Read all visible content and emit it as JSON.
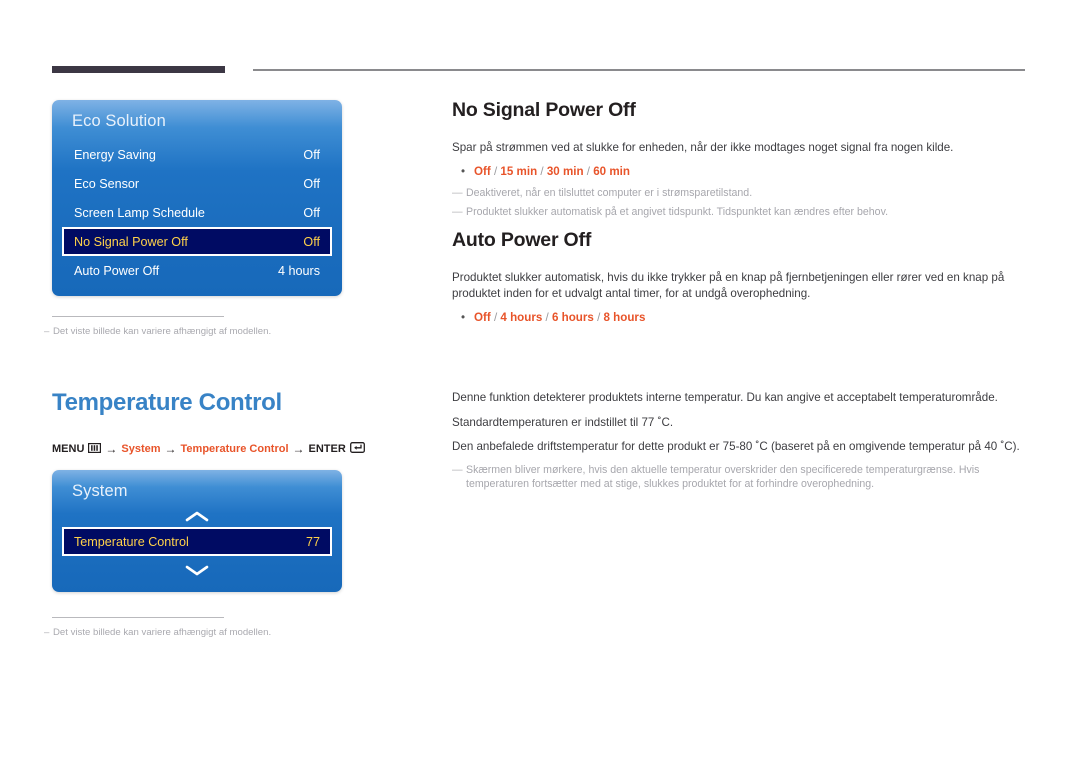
{
  "header": {
    "rule_dark_color": "#3c3744",
    "rule_light_color": "#8a8a8d"
  },
  "eco_panel": {
    "title": "Eco Solution",
    "rows": [
      {
        "label": "Energy Saving",
        "value": "Off",
        "selected": false
      },
      {
        "label": "Eco Sensor",
        "value": "Off",
        "selected": false
      },
      {
        "label": "Screen Lamp Schedule",
        "value": "Off",
        "selected": false
      },
      {
        "label": "No Signal Power Off",
        "value": "Off",
        "selected": true
      },
      {
        "label": "Auto Power Off",
        "value": "4 hours",
        "selected": false
      }
    ],
    "footnote": "Det viste billede kan variere afhængigt af modellen."
  },
  "system_panel": {
    "title": "System",
    "scroll_up_icon": "chevron-up-icon",
    "scroll_down_icon": "chevron-down-icon",
    "rows": [
      {
        "label": "Temperature Control",
        "value": "77",
        "selected": true
      }
    ],
    "footnote": "Det viste billede kan variere afhængigt af modellen."
  },
  "no_signal_power_off": {
    "title": "No Signal Power Off",
    "body": "Spar på strømmen ved at slukke for enheden, når der ikke modtages noget signal fra nogen kilde.",
    "options": [
      "Off",
      "15 min",
      "30 min",
      "60 min"
    ],
    "notes": [
      "Deaktiveret, når en tilsluttet computer er i strømsparetilstand.",
      "Produktet slukker automatisk på et angivet tidspunkt. Tidspunktet kan ændres efter behov."
    ]
  },
  "auto_power_off": {
    "title": "Auto Power Off",
    "body": "Produktet slukker automatisk, hvis du ikke trykker på en knap på fjernbetjeningen eller rører ved en knap på produktet inden for et udvalgt antal timer, for at undgå overophedning.",
    "options": [
      "Off",
      "4 hours",
      "6 hours",
      "8 hours"
    ]
  },
  "temperature_control": {
    "title": "Temperature Control",
    "menu_path": {
      "menu_label": "MENU",
      "menu_icon": "menu-icon",
      "arrow": "→",
      "step1": "System",
      "step2": "Temperature Control",
      "enter_label": "ENTER",
      "enter_icon": "enter-key-icon"
    },
    "paragraphs": [
      "Denne funktion detekterer produktets interne temperatur. Du kan angive et acceptabelt temperaturområde.",
      "Standardtemperaturen er indstillet til 77 ˚C.",
      "Den anbefalede driftstemperatur for dette produkt er 75-80 ˚C (baseret på en omgivende temperatur på 40 ˚C)."
    ],
    "note": "Skærmen bliver mørkere, hvis den aktuelle temperatur overskrider den specificerede temperaturgrænse. Hvis temperaturen fortsætter med at stige, slukkes produktet for at forhindre overophedning."
  },
  "colors": {
    "accent_blue": "#3883c6",
    "accent_orange": "#e8542a",
    "osd_blue": "#1f73c4",
    "osd_selected_bg": "#000b63",
    "osd_selected_text": "#ffd24a"
  }
}
